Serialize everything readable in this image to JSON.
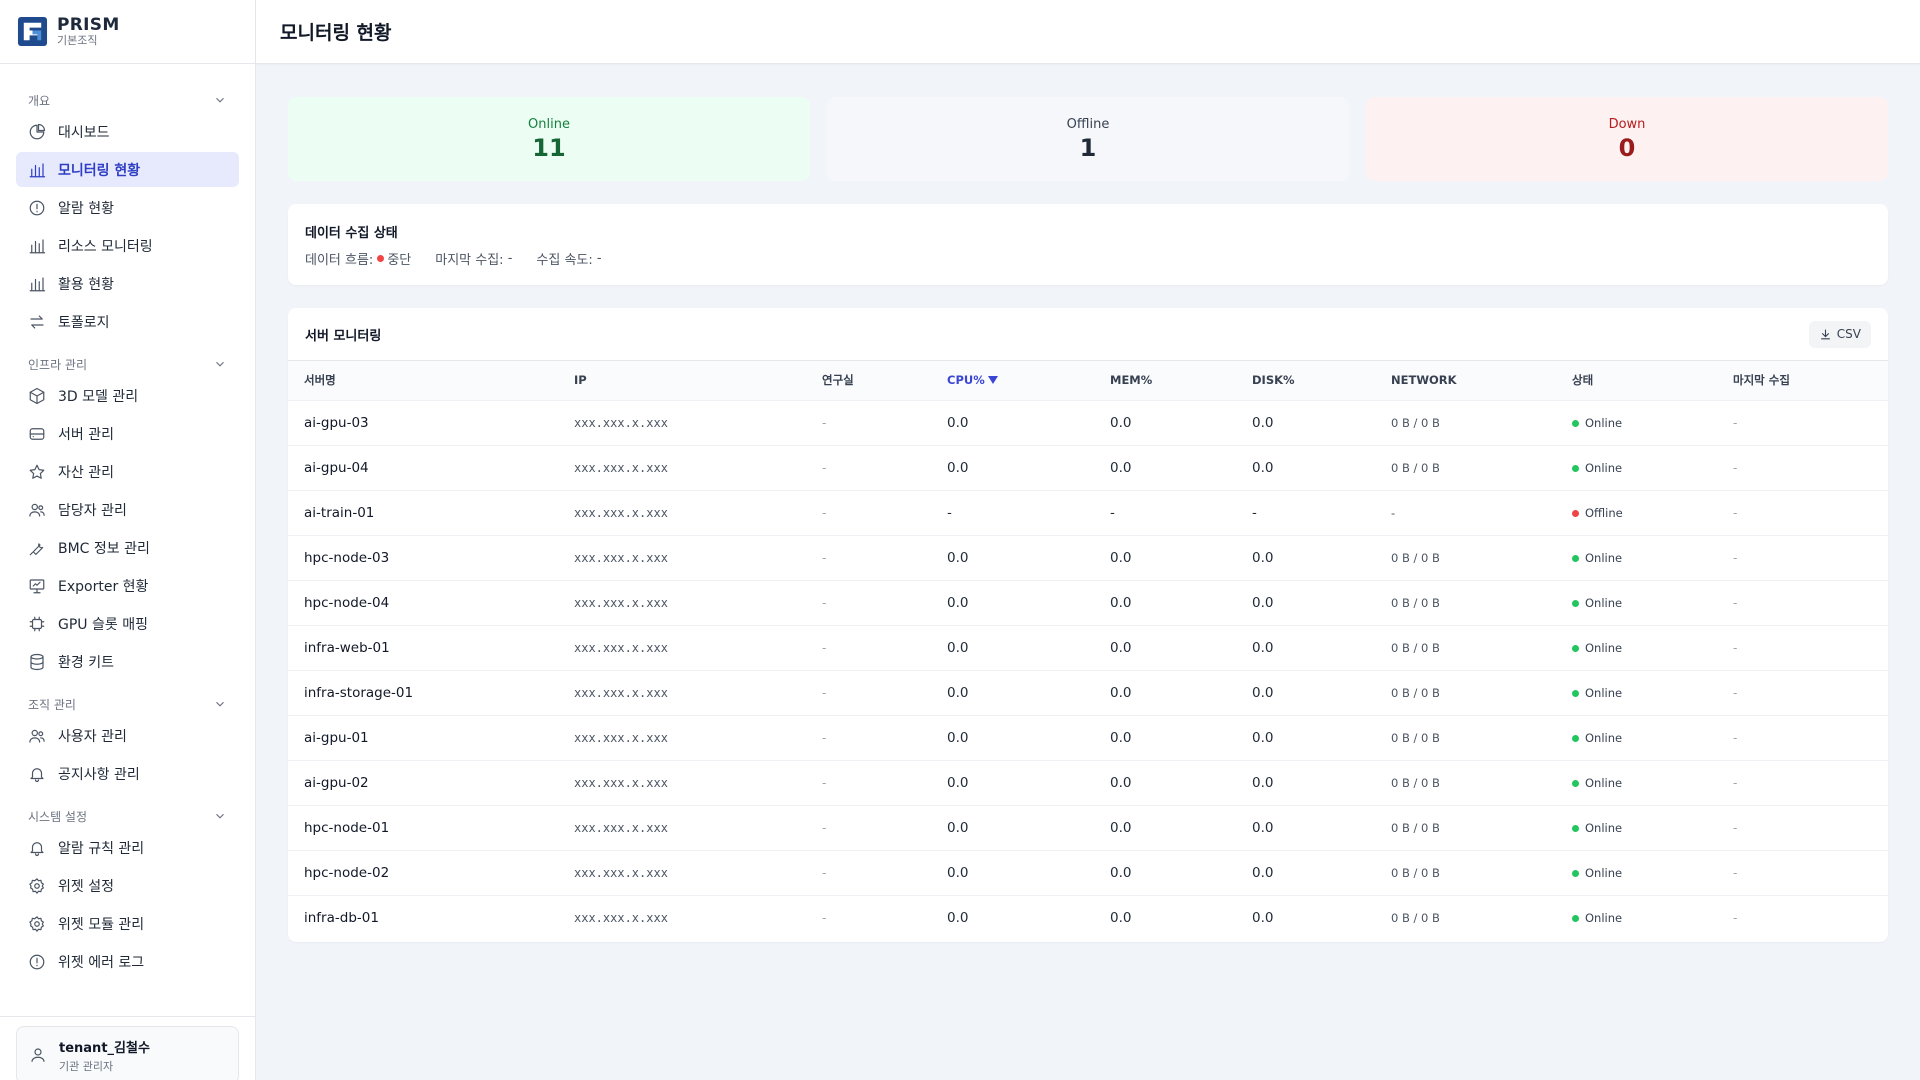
{
  "brand": {
    "name": "PRISM",
    "sub": "기본조직",
    "logo_icon": "prism-logo-icon"
  },
  "header": {
    "title": "모니터링 현황"
  },
  "sidebar": {
    "sections": [
      {
        "label": "개요",
        "items": [
          {
            "label": "대시보드",
            "icon": "pie-chart-icon"
          },
          {
            "label": "모니터링 현황",
            "icon": "bar-chart-icon",
            "active": true
          },
          {
            "label": "알람 현황",
            "icon": "alert-circle-icon"
          },
          {
            "label": "리소스 모니터링",
            "icon": "bar-chart-icon"
          },
          {
            "label": "활용 현황",
            "icon": "bar-chart-icon"
          },
          {
            "label": "토폴로지",
            "icon": "arrows-exchange-icon"
          }
        ]
      },
      {
        "label": "인프라 관리",
        "items": [
          {
            "label": "3D 모델 관리",
            "icon": "cube-icon"
          },
          {
            "label": "서버 관리",
            "icon": "server-icon"
          },
          {
            "label": "자산 관리",
            "icon": "star-icon"
          },
          {
            "label": "담당자 관리",
            "icon": "users-icon"
          },
          {
            "label": "BMC 정보 관리",
            "icon": "wrench-icon"
          },
          {
            "label": "Exporter 현황",
            "icon": "presentation-icon"
          },
          {
            "label": "GPU 슬롯 매핑",
            "icon": "chip-icon"
          },
          {
            "label": "환경 키트",
            "icon": "database-icon"
          }
        ]
      },
      {
        "label": "조직 관리",
        "items": [
          {
            "label": "사용자 관리",
            "icon": "users-icon"
          },
          {
            "label": "공지사항 관리",
            "icon": "bell-icon"
          }
        ]
      },
      {
        "label": "시스템 설정",
        "items": [
          {
            "label": "알람 규칙 관리",
            "icon": "bell-icon"
          },
          {
            "label": "위젯 설정",
            "icon": "gear-icon"
          },
          {
            "label": "위젯 모듈 관리",
            "icon": "gear-icon"
          },
          {
            "label": "위젯 에러 로그",
            "icon": "alert-circle-icon"
          }
        ]
      }
    ]
  },
  "user": {
    "name": "tenant_김철수",
    "role": "기관 관리자",
    "icon": "user-icon"
  },
  "stats": {
    "online": {
      "label": "Online",
      "value": "11"
    },
    "offline": {
      "label": "Offline",
      "value": "1"
    },
    "down": {
      "label": "Down",
      "value": "0"
    }
  },
  "collection": {
    "title": "데이터 수집 상태",
    "flow_label": "데이터 흐름:",
    "flow_value": "중단",
    "last_label": "마지막 수집:",
    "last_value": "-",
    "speed_label": "수집 속도:",
    "speed_value": "-"
  },
  "servers": {
    "title": "서버 모니터링",
    "csv_label": "CSV",
    "columns": [
      "서버명",
      "IP",
      "연구실",
      "CPU%",
      "MEM%",
      "DISK%",
      "NETWORK",
      "상태",
      "마지막 수집"
    ],
    "sorted_column": "CPU%",
    "rows": [
      {
        "name": "ai-gpu-03",
        "ip": "xxx.xxx.x.xxx",
        "lab": "-",
        "cpu": "0.0",
        "mem": "0.0",
        "disk": "0.0",
        "net": "0 B / 0 B",
        "status": "Online",
        "last": "-"
      },
      {
        "name": "ai-gpu-04",
        "ip": "xxx.xxx.x.xxx",
        "lab": "-",
        "cpu": "0.0",
        "mem": "0.0",
        "disk": "0.0",
        "net": "0 B / 0 B",
        "status": "Online",
        "last": "-"
      },
      {
        "name": "ai-train-01",
        "ip": "xxx.xxx.x.xxx",
        "lab": "-",
        "cpu": "-",
        "mem": "-",
        "disk": "-",
        "net": "-",
        "status": "Offline",
        "last": "-"
      },
      {
        "name": "hpc-node-03",
        "ip": "xxx.xxx.x.xxx",
        "lab": "-",
        "cpu": "0.0",
        "mem": "0.0",
        "disk": "0.0",
        "net": "0 B / 0 B",
        "status": "Online",
        "last": "-"
      },
      {
        "name": "hpc-node-04",
        "ip": "xxx.xxx.x.xxx",
        "lab": "-",
        "cpu": "0.0",
        "mem": "0.0",
        "disk": "0.0",
        "net": "0 B / 0 B",
        "status": "Online",
        "last": "-"
      },
      {
        "name": "infra-web-01",
        "ip": "xxx.xxx.x.xxx",
        "lab": "-",
        "cpu": "0.0",
        "mem": "0.0",
        "disk": "0.0",
        "net": "0 B / 0 B",
        "status": "Online",
        "last": "-"
      },
      {
        "name": "infra-storage-01",
        "ip": "xxx.xxx.x.xxx",
        "lab": "-",
        "cpu": "0.0",
        "mem": "0.0",
        "disk": "0.0",
        "net": "0 B / 0 B",
        "status": "Online",
        "last": "-"
      },
      {
        "name": "ai-gpu-01",
        "ip": "xxx.xxx.x.xxx",
        "lab": "-",
        "cpu": "0.0",
        "mem": "0.0",
        "disk": "0.0",
        "net": "0 B / 0 B",
        "status": "Online",
        "last": "-"
      },
      {
        "name": "ai-gpu-02",
        "ip": "xxx.xxx.x.xxx",
        "lab": "-",
        "cpu": "0.0",
        "mem": "0.0",
        "disk": "0.0",
        "net": "0 B / 0 B",
        "status": "Online",
        "last": "-"
      },
      {
        "name": "hpc-node-01",
        "ip": "xxx.xxx.x.xxx",
        "lab": "-",
        "cpu": "0.0",
        "mem": "0.0",
        "disk": "0.0",
        "net": "0 B / 0 B",
        "status": "Online",
        "last": "-"
      },
      {
        "name": "hpc-node-02",
        "ip": "xxx.xxx.x.xxx",
        "lab": "-",
        "cpu": "0.0",
        "mem": "0.0",
        "disk": "0.0",
        "net": "0 B / 0 B",
        "status": "Online",
        "last": "-"
      },
      {
        "name": "infra-db-01",
        "ip": "xxx.xxx.x.xxx",
        "lab": "-",
        "cpu": "0.0",
        "mem": "0.0",
        "disk": "0.0",
        "net": "0 B / 0 B",
        "status": "Online",
        "last": "-"
      }
    ]
  },
  "colors": {
    "accent": "#3b46d6",
    "online": "#22c55e",
    "offline": "#ef4444"
  }
}
